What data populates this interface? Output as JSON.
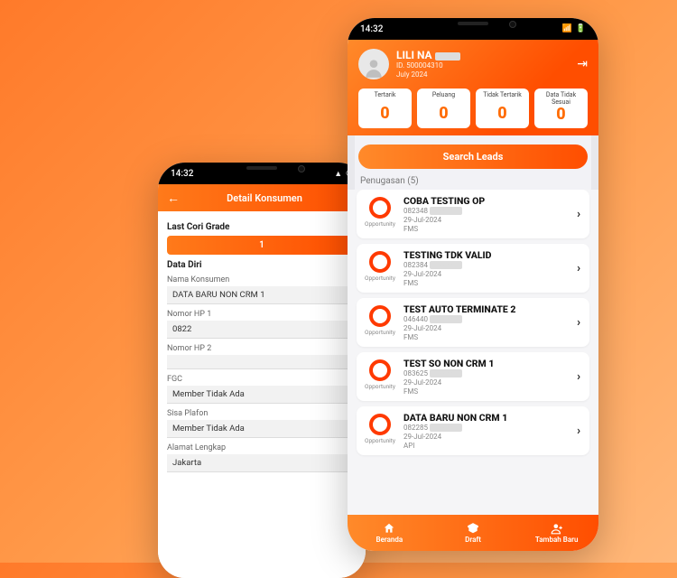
{
  "colors": {
    "accent": "#ff6a00",
    "accent2": "#ff4e00"
  },
  "status_time": "14:32",
  "back_phone": {
    "header_title": "Detail Konsumen",
    "grade_label": "Last Cori Grade",
    "grade_value": "1",
    "section_label": "Data Diri",
    "fields": {
      "nama_label": "Nama Konsumen",
      "nama_value": "DATA BARU NON CRM 1",
      "hp1_label": "Nomor HP 1",
      "hp1_value": "0822",
      "hp2_label": "Nomor HP 2",
      "hp2_value": "",
      "fgc_label": "FGC",
      "fgc_value": "Member Tidak Ada",
      "plafon_label": "Sisa Plafon",
      "plafon_value": "Member Tidak Ada",
      "alamat_label": "Alamat Lengkap",
      "alamat_value": "Jakarta"
    }
  },
  "front_phone": {
    "profile": {
      "name": "LILI NA",
      "id_line": "ID. 500004310",
      "period": "July 2024"
    },
    "stats": [
      {
        "label": "Tertarik",
        "value": "0"
      },
      {
        "label": "Peluang",
        "value": "0"
      },
      {
        "label": "Tidak Tertarik",
        "value": "0"
      },
      {
        "label": "Data Tidak Sesuai",
        "value": "0"
      }
    ],
    "search_label": "Search Leads",
    "list_header": "Penugasan  (5)",
    "items": [
      {
        "title": "COBA TESTING OP",
        "code": "082348",
        "date": "29-Jul-2024",
        "src": "FMS",
        "tag": "Opportunity"
      },
      {
        "title": "TESTING TDK VALID",
        "code": "082384",
        "date": "29-Jul-2024",
        "src": "FMS",
        "tag": "Opportunity"
      },
      {
        "title": "TEST AUTO TERMINATE 2",
        "code": "046440",
        "date": "29-Jul-2024",
        "src": "FMS",
        "tag": "Opportunity"
      },
      {
        "title": "TEST SO NON CRM 1",
        "code": "083625",
        "date": "29-Jul-2024",
        "src": "FMS",
        "tag": "Opportunity"
      },
      {
        "title": "DATA BARU NON CRM 1",
        "code": "082285",
        "date": "29-Jul-2024",
        "src": "API",
        "tag": "Opportunity"
      }
    ],
    "nav": {
      "home": "Beranda",
      "draft": "Draft",
      "add": "Tambah Baru"
    }
  }
}
